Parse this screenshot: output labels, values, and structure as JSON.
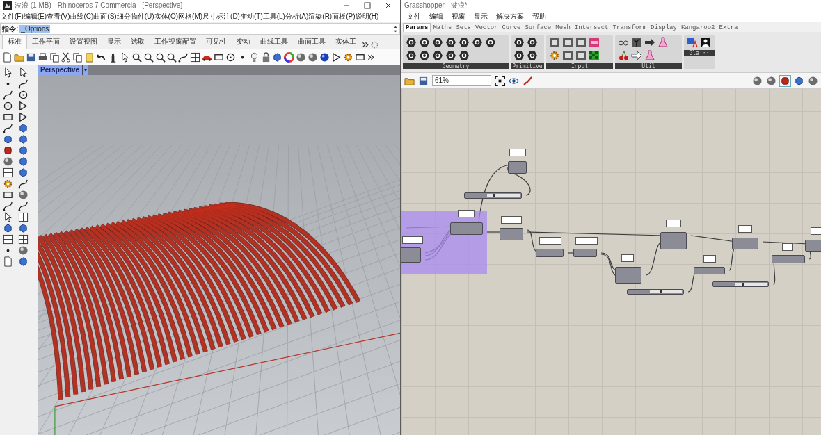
{
  "rhino": {
    "window": {
      "title": "波浪 (1 MB) - Rhinoceros 7 Commercia - [Perspective]"
    },
    "menu": [
      "文件(F)",
      "编辑(E)",
      "查看(V)",
      "曲线(C)",
      "曲面(S)",
      "细分物件(U)",
      "实体(O)",
      "网格(M)",
      "尺寸标注(D)",
      "变动(T)",
      "工具(L)",
      "分析(A)",
      "渲染(R)",
      "面板(P)",
      "说明(H)"
    ],
    "command": {
      "label": "指令:",
      "value": "_Options"
    },
    "tabs": [
      {
        "label": "标准",
        "selected": true
      },
      {
        "label": "工作平面",
        "selected": false
      },
      {
        "label": "设置视图",
        "selected": false
      },
      {
        "label": "显示",
        "selected": false
      },
      {
        "label": "选取",
        "selected": false
      },
      {
        "label": "工作视窗配置",
        "selected": false
      },
      {
        "label": "可见性",
        "selected": false
      },
      {
        "label": "变动",
        "selected": false
      },
      {
        "label": "曲线工具",
        "selected": false
      },
      {
        "label": "曲面工具",
        "selected": false
      },
      {
        "label": "实体工",
        "selected": false
      }
    ],
    "viewport": {
      "label": "Perspective"
    }
  },
  "grasshopper": {
    "window": {
      "title": "Grasshopper - 波浪*"
    },
    "menu": [
      "文件",
      "编辑",
      "视窗",
      "显示",
      "解决方案",
      "帮助"
    ],
    "tabs": [
      {
        "label": "Params",
        "selected": true
      },
      {
        "label": "Maths",
        "selected": false
      },
      {
        "label": "Sets",
        "selected": false
      },
      {
        "label": "Vector",
        "selected": false
      },
      {
        "label": "Curve",
        "selected": false
      },
      {
        "label": "Surface",
        "selected": false
      },
      {
        "label": "Mesh",
        "selected": false
      },
      {
        "label": "Intersect",
        "selected": false
      },
      {
        "label": "Transform",
        "selected": false
      },
      {
        "label": "Display",
        "selected": false
      },
      {
        "label": "Kangaroo2",
        "selected": false
      },
      {
        "label": "Extra",
        "selected": false
      }
    ],
    "panels": [
      {
        "label": "Geometry"
      },
      {
        "label": "Primitive"
      },
      {
        "label": "Input"
      },
      {
        "label": "Util"
      },
      {
        "label": "Gla···"
      }
    ],
    "zoom": "61%",
    "nodes": [
      {
        "kind": "group"
      },
      {
        "kind": "component"
      },
      {
        "kind": "slider",
        "level": 0.2
      },
      {
        "kind": "component"
      },
      {
        "kind": "component"
      },
      {
        "kind": "component"
      },
      {
        "kind": "component"
      },
      {
        "kind": "component"
      },
      {
        "kind": "component"
      },
      {
        "kind": "component"
      },
      {
        "kind": "component"
      },
      {
        "kind": "component"
      },
      {
        "kind": "component"
      },
      {
        "kind": "component"
      },
      {
        "kind": "slider",
        "level": 0.3
      },
      {
        "kind": "slider",
        "level": 0.2
      }
    ]
  }
}
